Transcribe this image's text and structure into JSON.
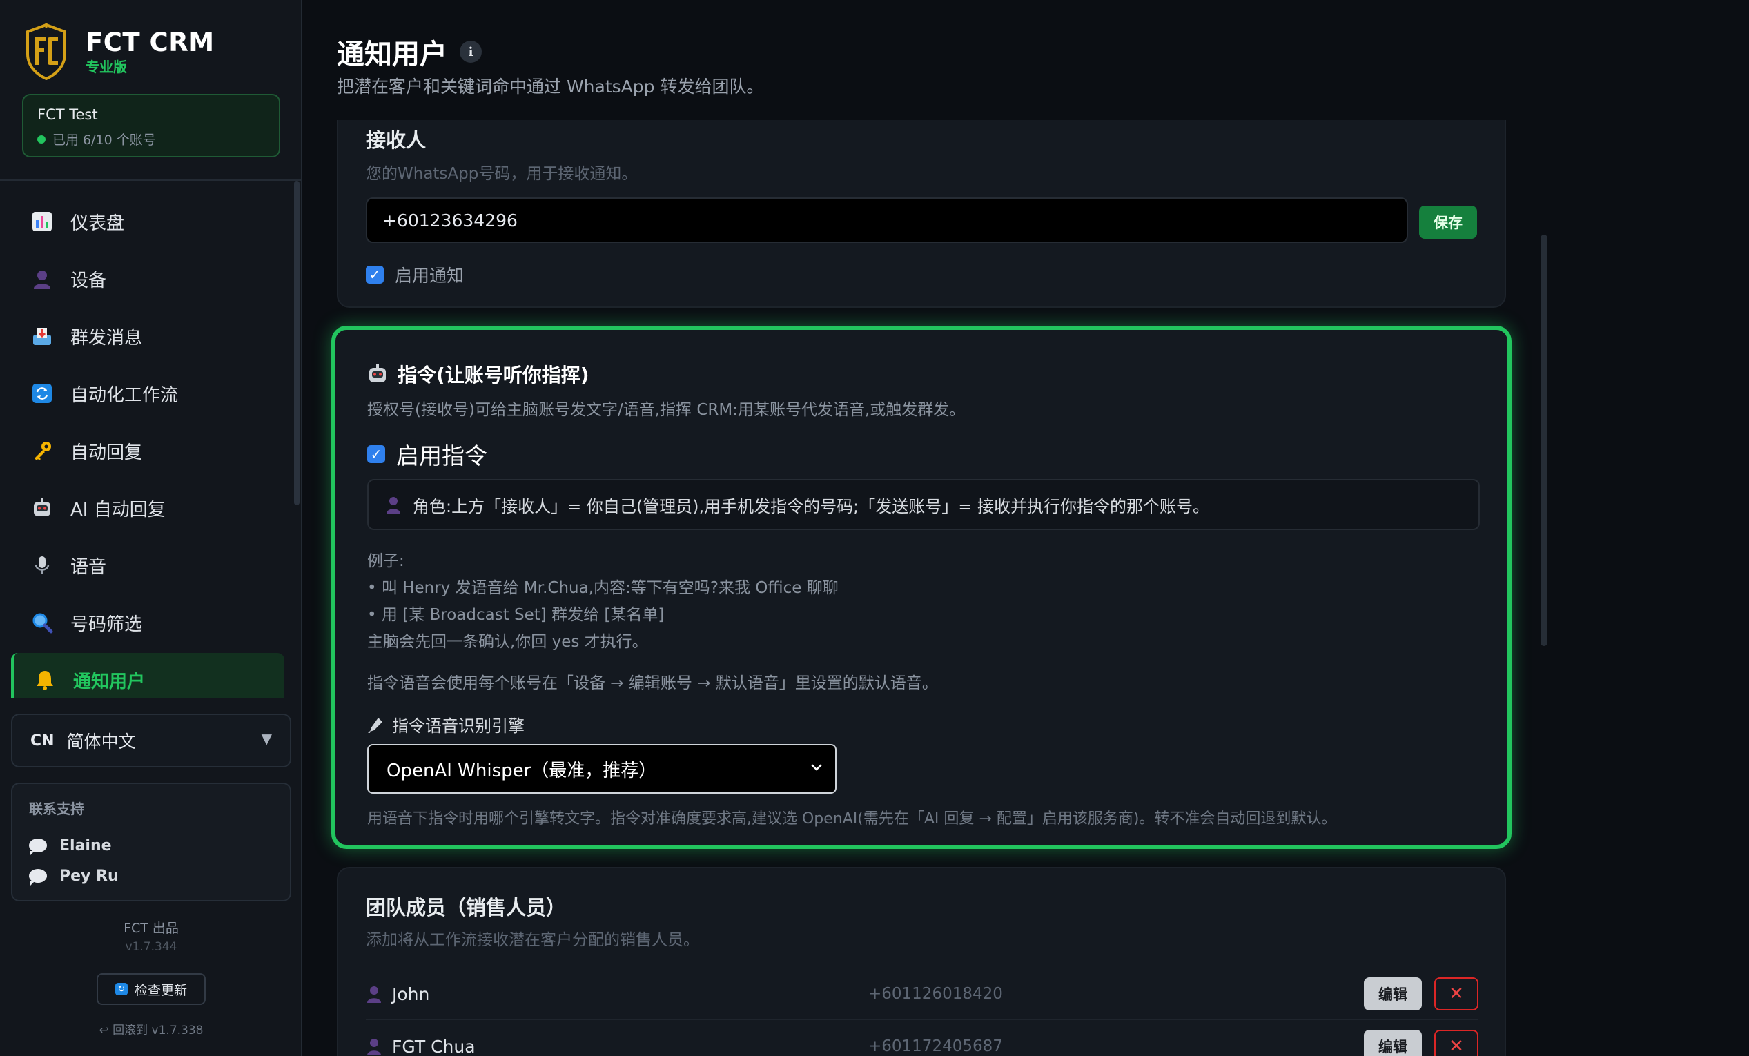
{
  "brand": {
    "name": "FCT CRM",
    "edition": "专业版"
  },
  "account": {
    "name": "FCT Test",
    "usage": "已用 6/10 个账号"
  },
  "nav": [
    {
      "label": "仪表盘",
      "icon": "bar-chart-icon"
    },
    {
      "label": "设备",
      "icon": "user-icon"
    },
    {
      "label": "群发消息",
      "icon": "inbox-tray-icon"
    },
    {
      "label": "自动化工作流",
      "icon": "refresh-icon"
    },
    {
      "label": "自动回复",
      "icon": "key-icon"
    },
    {
      "label": "AI 自动回复",
      "icon": "robot-icon"
    },
    {
      "label": "语音",
      "icon": "microphone-icon"
    },
    {
      "label": "号码筛选",
      "icon": "magnifier-icon"
    },
    {
      "label": "通知用户",
      "icon": "bell-icon",
      "active": true
    }
  ],
  "language": {
    "code": "CN",
    "label": "简体中文"
  },
  "support": {
    "title": "联系支持",
    "contacts": [
      "Elaine",
      "Pey Ru"
    ]
  },
  "footer": {
    "maker": "FCT 出品",
    "version": "v1.7.344",
    "update_label": "检查更新",
    "rollback_label": "↩ 回滚到 v1.7.338"
  },
  "page": {
    "title": "通知用户",
    "subtitle": "把潜在客户和关键词命中通过 WhatsApp 转发给团队。"
  },
  "recipient": {
    "title": "接收人",
    "desc": "您的WhatsApp号码，用于接收通知。",
    "phone": "+60123634296",
    "save_label": "保存",
    "enable_label": "启用通知",
    "enabled": true
  },
  "command": {
    "title": "指令(让账号听你指挥)",
    "desc": "授权号(接收号)可给主脑账号发文字/语音,指挥 CRM:用某账号代发语音,或触发群发。",
    "enable_label": "启用指令",
    "enabled": true,
    "role_note": "角色:上方「接收人」= 你自己(管理员),用手机发指令的号码;「发送账号」= 接收并执行你指令的那个账号。",
    "examples_title": "例子:",
    "examples": [
      "• 叫 Henry 发语音给 Mr.Chua,内容:等下有空吗?来我 Office 聊聊",
      "• 用 [某 Broadcast Set] 群发给 [某名单]",
      "主脑会先回一条确认,你回 yes 才执行。"
    ],
    "voice_note": "指令语音会使用每个账号在「设备 → 编辑账号 → 默认语音」里设置的默认语音。",
    "engine_label": "指令语音识别引擎",
    "engine_value": "OpenAI Whisper（最准，推荐）",
    "engine_hint": "用语音下指令时用哪个引擎转文字。指令对准确度要求高,建议选 OpenAI(需先在「AI 回复 → 配置」启用该服务商)。转不准会自动回退到默认。"
  },
  "team": {
    "title": "团队成员（销售人员）",
    "desc": "添加将从工作流接收潜在客户分配的销售人员。",
    "edit_label": "编辑",
    "delete_label": "✕",
    "members": [
      {
        "name": "John",
        "phone": "+601126018420"
      },
      {
        "name": "FGT Chua",
        "phone": "+601172405687"
      }
    ]
  },
  "colors": {
    "accent": "#22c55e",
    "danger": "#dc2626",
    "checkbox": "#2f80ed"
  }
}
